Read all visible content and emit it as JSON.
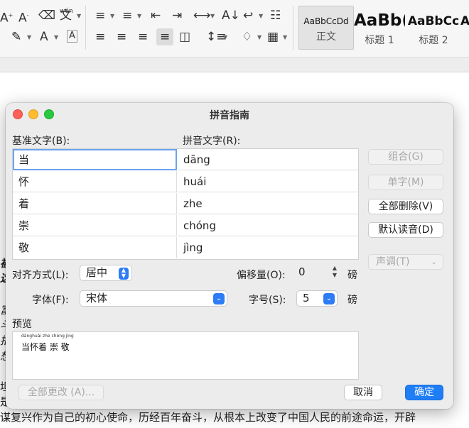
{
  "ribbon": {
    "icons": [
      "font-size-increase-icon",
      "font-size-decrease-icon",
      "clear-format-icon",
      "phonetic-guide-icon",
      "bullets-icon",
      "numbering-icon",
      "decrease-indent-icon",
      "increase-indent-icon",
      "text-direction-icon",
      "sort-icon",
      "line-break-icon",
      "table-icon",
      "highlight-icon",
      "font-color-icon",
      "char-border-icon",
      "align-left-icon",
      "align-center-icon",
      "align-right-icon",
      "justify-icon",
      "distributed-icon",
      "line-spacing-icon",
      "shading-icon",
      "borders-icon"
    ],
    "styles": [
      {
        "sample": "AaBbCcDd",
        "name": "正文"
      },
      {
        "sample": "AaBb(",
        "name": "标题 1"
      },
      {
        "sample": "AaBbCc",
        "name": "标题 2"
      },
      {
        "sample": "A",
        "name": ""
      }
    ]
  },
  "dialog": {
    "title": "拼音指南",
    "base_label": "基准文字(B):",
    "pinyin_label": "拼音文字(R):",
    "rows": [
      {
        "base": "当",
        "pinyin": "dāng"
      },
      {
        "base": "怀",
        "pinyin": "huái"
      },
      {
        "base": "着",
        "pinyin": "zhe"
      },
      {
        "base": "崇",
        "pinyin": "chóng"
      },
      {
        "base": "敬",
        "pinyin": "jìng"
      }
    ],
    "buttons": {
      "combine": "组合(G)",
      "single": "单字(M)",
      "clear_all": "全部删除(V)",
      "default_reading": "默认读音(D)",
      "tone": "声调(T)",
      "apply_all": "全部更改 (A)...",
      "cancel": "取消",
      "ok": "确定"
    },
    "align_label": "对齐方式(L):",
    "align_value": "居中",
    "offset_label": "偏移量(O):",
    "offset_value": "0",
    "offset_unit": "磅",
    "font_label": "字体(F):",
    "font_value": "宋体",
    "size_label": "字号(S):",
    "size_value": "5",
    "size_unit": "磅",
    "preview_label": "预览",
    "preview_pinyin": "dānghuái zhe chóng jìng",
    "preview_text": "当怀着 崇 敬"
  },
  "document": {
    "fragments": [
      "被",
      "这",
      "富",
      "斗",
      "拍",
      "想",
      "坦",
      "是"
    ],
    "bottom_line": "谋复兴作为自己的初心使命，历经百年奋斗，从根本上改变了中国人民的前途命运，开辟"
  }
}
